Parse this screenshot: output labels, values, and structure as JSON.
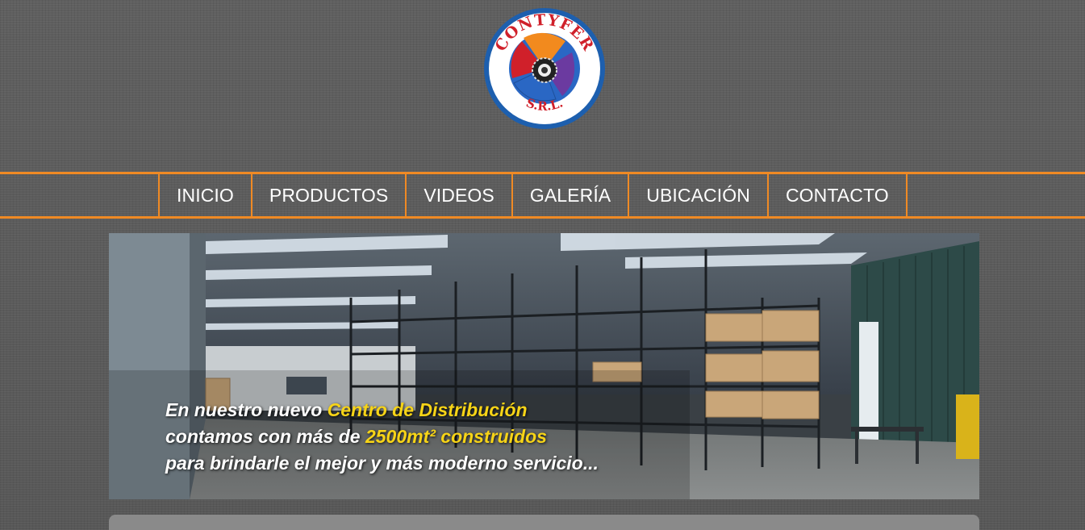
{
  "logo": {
    "brand_top": "CONTYFER",
    "brand_bottom": "S.R.L.",
    "icon": "contyfer-logo-icon",
    "colors": {
      "ring": "#1d5fae",
      "lettering": "#d0202a",
      "orange": "#f28a1e",
      "purple": "#6b3aa0",
      "blue": "#2a67c4"
    }
  },
  "nav": {
    "items": [
      {
        "label": "INICIO"
      },
      {
        "label": "PRODUCTOS"
      },
      {
        "label": "VIDEOS"
      },
      {
        "label": "GALERÍA"
      },
      {
        "label": "UBICACIÓN"
      },
      {
        "label": "CONTACTO"
      }
    ],
    "accent_color": "#f08a24"
  },
  "banner": {
    "image": "warehouse-photo",
    "line1_a": "En nuestro nuevo ",
    "line1_b": "Centro de Distribución",
    "line2_a": "contamos con más de ",
    "line2_b": "2500mt² construidos",
    "line3": "para brindarle el mejor y más moderno servicio...",
    "highlight_color": "#f7d417"
  }
}
